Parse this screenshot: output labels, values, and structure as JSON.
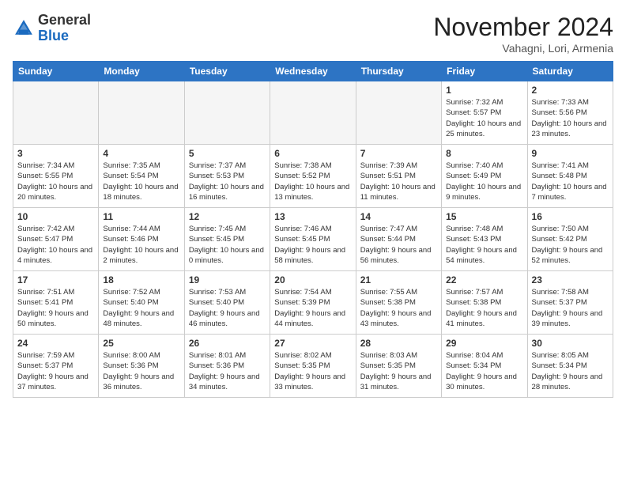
{
  "header": {
    "logo_general": "General",
    "logo_blue": "Blue",
    "month_title": "November 2024",
    "location": "Vahagni, Lori, Armenia"
  },
  "weekdays": [
    "Sunday",
    "Monday",
    "Tuesday",
    "Wednesday",
    "Thursday",
    "Friday",
    "Saturday"
  ],
  "weeks": [
    [
      {
        "day": "",
        "info": ""
      },
      {
        "day": "",
        "info": ""
      },
      {
        "day": "",
        "info": ""
      },
      {
        "day": "",
        "info": ""
      },
      {
        "day": "",
        "info": ""
      },
      {
        "day": "1",
        "info": "Sunrise: 7:32 AM\nSunset: 5:57 PM\nDaylight: 10 hours and 25 minutes."
      },
      {
        "day": "2",
        "info": "Sunrise: 7:33 AM\nSunset: 5:56 PM\nDaylight: 10 hours and 23 minutes."
      }
    ],
    [
      {
        "day": "3",
        "info": "Sunrise: 7:34 AM\nSunset: 5:55 PM\nDaylight: 10 hours and 20 minutes."
      },
      {
        "day": "4",
        "info": "Sunrise: 7:35 AM\nSunset: 5:54 PM\nDaylight: 10 hours and 18 minutes."
      },
      {
        "day": "5",
        "info": "Sunrise: 7:37 AM\nSunset: 5:53 PM\nDaylight: 10 hours and 16 minutes."
      },
      {
        "day": "6",
        "info": "Sunrise: 7:38 AM\nSunset: 5:52 PM\nDaylight: 10 hours and 13 minutes."
      },
      {
        "day": "7",
        "info": "Sunrise: 7:39 AM\nSunset: 5:51 PM\nDaylight: 10 hours and 11 minutes."
      },
      {
        "day": "8",
        "info": "Sunrise: 7:40 AM\nSunset: 5:49 PM\nDaylight: 10 hours and 9 minutes."
      },
      {
        "day": "9",
        "info": "Sunrise: 7:41 AM\nSunset: 5:48 PM\nDaylight: 10 hours and 7 minutes."
      }
    ],
    [
      {
        "day": "10",
        "info": "Sunrise: 7:42 AM\nSunset: 5:47 PM\nDaylight: 10 hours and 4 minutes."
      },
      {
        "day": "11",
        "info": "Sunrise: 7:44 AM\nSunset: 5:46 PM\nDaylight: 10 hours and 2 minutes."
      },
      {
        "day": "12",
        "info": "Sunrise: 7:45 AM\nSunset: 5:45 PM\nDaylight: 10 hours and 0 minutes."
      },
      {
        "day": "13",
        "info": "Sunrise: 7:46 AM\nSunset: 5:45 PM\nDaylight: 9 hours and 58 minutes."
      },
      {
        "day": "14",
        "info": "Sunrise: 7:47 AM\nSunset: 5:44 PM\nDaylight: 9 hours and 56 minutes."
      },
      {
        "day": "15",
        "info": "Sunrise: 7:48 AM\nSunset: 5:43 PM\nDaylight: 9 hours and 54 minutes."
      },
      {
        "day": "16",
        "info": "Sunrise: 7:50 AM\nSunset: 5:42 PM\nDaylight: 9 hours and 52 minutes."
      }
    ],
    [
      {
        "day": "17",
        "info": "Sunrise: 7:51 AM\nSunset: 5:41 PM\nDaylight: 9 hours and 50 minutes."
      },
      {
        "day": "18",
        "info": "Sunrise: 7:52 AM\nSunset: 5:40 PM\nDaylight: 9 hours and 48 minutes."
      },
      {
        "day": "19",
        "info": "Sunrise: 7:53 AM\nSunset: 5:40 PM\nDaylight: 9 hours and 46 minutes."
      },
      {
        "day": "20",
        "info": "Sunrise: 7:54 AM\nSunset: 5:39 PM\nDaylight: 9 hours and 44 minutes."
      },
      {
        "day": "21",
        "info": "Sunrise: 7:55 AM\nSunset: 5:38 PM\nDaylight: 9 hours and 43 minutes."
      },
      {
        "day": "22",
        "info": "Sunrise: 7:57 AM\nSunset: 5:38 PM\nDaylight: 9 hours and 41 minutes."
      },
      {
        "day": "23",
        "info": "Sunrise: 7:58 AM\nSunset: 5:37 PM\nDaylight: 9 hours and 39 minutes."
      }
    ],
    [
      {
        "day": "24",
        "info": "Sunrise: 7:59 AM\nSunset: 5:37 PM\nDaylight: 9 hours and 37 minutes."
      },
      {
        "day": "25",
        "info": "Sunrise: 8:00 AM\nSunset: 5:36 PM\nDaylight: 9 hours and 36 minutes."
      },
      {
        "day": "26",
        "info": "Sunrise: 8:01 AM\nSunset: 5:36 PM\nDaylight: 9 hours and 34 minutes."
      },
      {
        "day": "27",
        "info": "Sunrise: 8:02 AM\nSunset: 5:35 PM\nDaylight: 9 hours and 33 minutes."
      },
      {
        "day": "28",
        "info": "Sunrise: 8:03 AM\nSunset: 5:35 PM\nDaylight: 9 hours and 31 minutes."
      },
      {
        "day": "29",
        "info": "Sunrise: 8:04 AM\nSunset: 5:34 PM\nDaylight: 9 hours and 30 minutes."
      },
      {
        "day": "30",
        "info": "Sunrise: 8:05 AM\nSunset: 5:34 PM\nDaylight: 9 hours and 28 minutes."
      }
    ]
  ]
}
